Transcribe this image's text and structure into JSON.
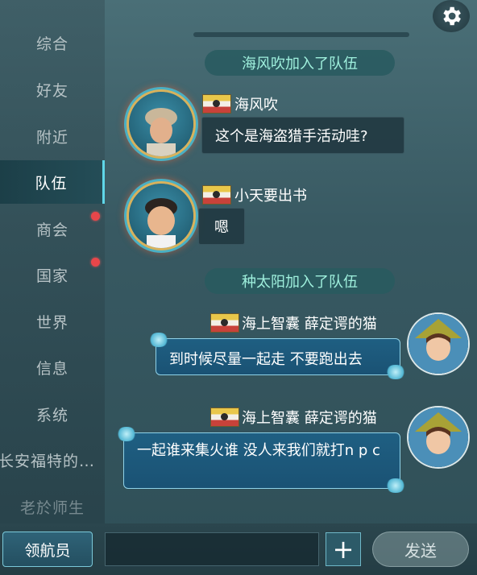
{
  "sidebar": {
    "items": [
      {
        "label": "综合"
      },
      {
        "label": "好友"
      },
      {
        "label": "附近"
      },
      {
        "label": "队伍"
      },
      {
        "label": "商会"
      },
      {
        "label": "国家"
      },
      {
        "label": "世界"
      },
      {
        "label": "信息"
      },
      {
        "label": "系统"
      },
      {
        "label": "长安福特的…"
      },
      {
        "label": "老於师生"
      }
    ],
    "active": "队伍"
  },
  "messages": {
    "system1": "海风吹加入了队伍",
    "msg1": {
      "name": "海风吹",
      "text": "这个是海盗猎手活动哇?"
    },
    "msg2": {
      "name": "小天要出书",
      "text": "嗯"
    },
    "system2": "种太阳加入了队伍",
    "msg3": {
      "name": "海上智囊 薛定谔的猫",
      "text": "到时候尽量一起走 不要跑出去"
    },
    "msg4": {
      "name": "海上智囊 薛定谔的猫",
      "text": "一起谁来集火谁 没人来我们就打n p c"
    }
  },
  "bottom": {
    "channel_button": "领航员",
    "input_value": "",
    "plus_label": "+",
    "send_label": "发送"
  },
  "colors": {
    "accent": "#5fd6e8",
    "system_text": "#9ff0dd",
    "badge": "#e8464a"
  },
  "icons": {
    "settings": "gear-icon",
    "add": "plus-icon"
  }
}
